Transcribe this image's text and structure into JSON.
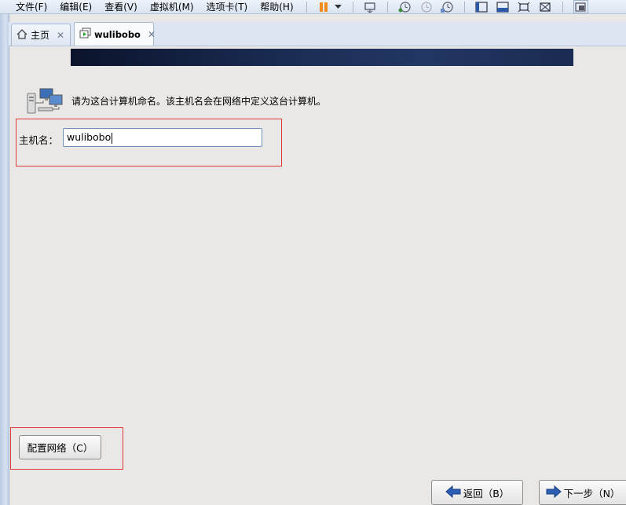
{
  "menu": {
    "items": [
      "文件(F)",
      "编辑(E)",
      "查看(V)",
      "虚拟机(M)",
      "选项卡(T)",
      "帮助(H)"
    ]
  },
  "toolbar": {
    "icons": [
      "pause-icon",
      "dropdown-icon",
      "send-keys-icon",
      "snapshot-icon",
      "revert-snapshot-icon",
      "snapshot-manager-icon",
      "console-view-icon",
      "thumbnail-view-icon",
      "fullscreen-icon",
      "unity-icon",
      "library-icon"
    ]
  },
  "tabs": [
    {
      "label": "主页",
      "icon": "home-icon",
      "active": false
    },
    {
      "label": "wulibobo",
      "icon": "vm-icon",
      "active": true
    }
  ],
  "installer": {
    "instruction": "请为这台计算机命名。该主机名会在网络中定义这台计算机。",
    "hostname_label": "主机名：",
    "hostname_value": "wulibobo",
    "configure_network_label": "配置网络（C）",
    "back_label": "返回（B）",
    "next_label": "下一步（N）"
  },
  "colors": {
    "highlight": "#e23a3a",
    "banner": "#142244",
    "window_frame": "#c4d3e8"
  }
}
